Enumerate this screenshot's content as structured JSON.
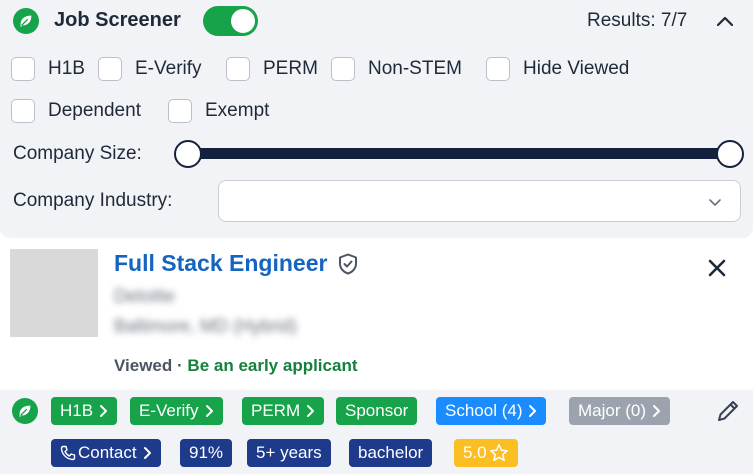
{
  "header": {
    "title": "Job Screener",
    "toggle_on": true,
    "results": "Results: 7/7"
  },
  "filters": {
    "checkboxes": [
      "H1B",
      "E-Verify",
      "PERM",
      "Non-STEM",
      "Hide Viewed",
      "Dependent",
      "Exempt"
    ],
    "company_size_label": "Company Size:",
    "company_industry_label": "Company Industry:",
    "company_industry_value": ""
  },
  "job": {
    "title": "Full Stack Engineer",
    "company": "Deloitte",
    "location": "Baltimore, MD (Hybrid)",
    "viewed": "Viewed",
    "separator": "·",
    "note": "Be an early applicant"
  },
  "tags": {
    "h1b": "H1B",
    "everify": "E-Verify",
    "perm": "PERM",
    "sponsor": "Sponsor",
    "school": "School (4)",
    "major": "Major (0)",
    "contact": "Contact",
    "match": "91%",
    "experience": "5+ years",
    "degree": "bachelor",
    "rating": "5.0"
  },
  "colors": {
    "brand_green": "#16a34a",
    "title_blue": "#1565c0",
    "school_blue": "#1a8cff",
    "navy": "#1e3a8a",
    "gray": "#9ca3af",
    "rating_yellow": "#fbbf24",
    "slider_navy": "#14213d"
  },
  "icons": {
    "logo": "leaf-logo-icon",
    "collapse": "chevron-up-icon",
    "verified": "shield-check-icon",
    "close": "close-icon",
    "edit": "pencil-icon",
    "contact": "phone-icon",
    "rating": "star-icon"
  }
}
